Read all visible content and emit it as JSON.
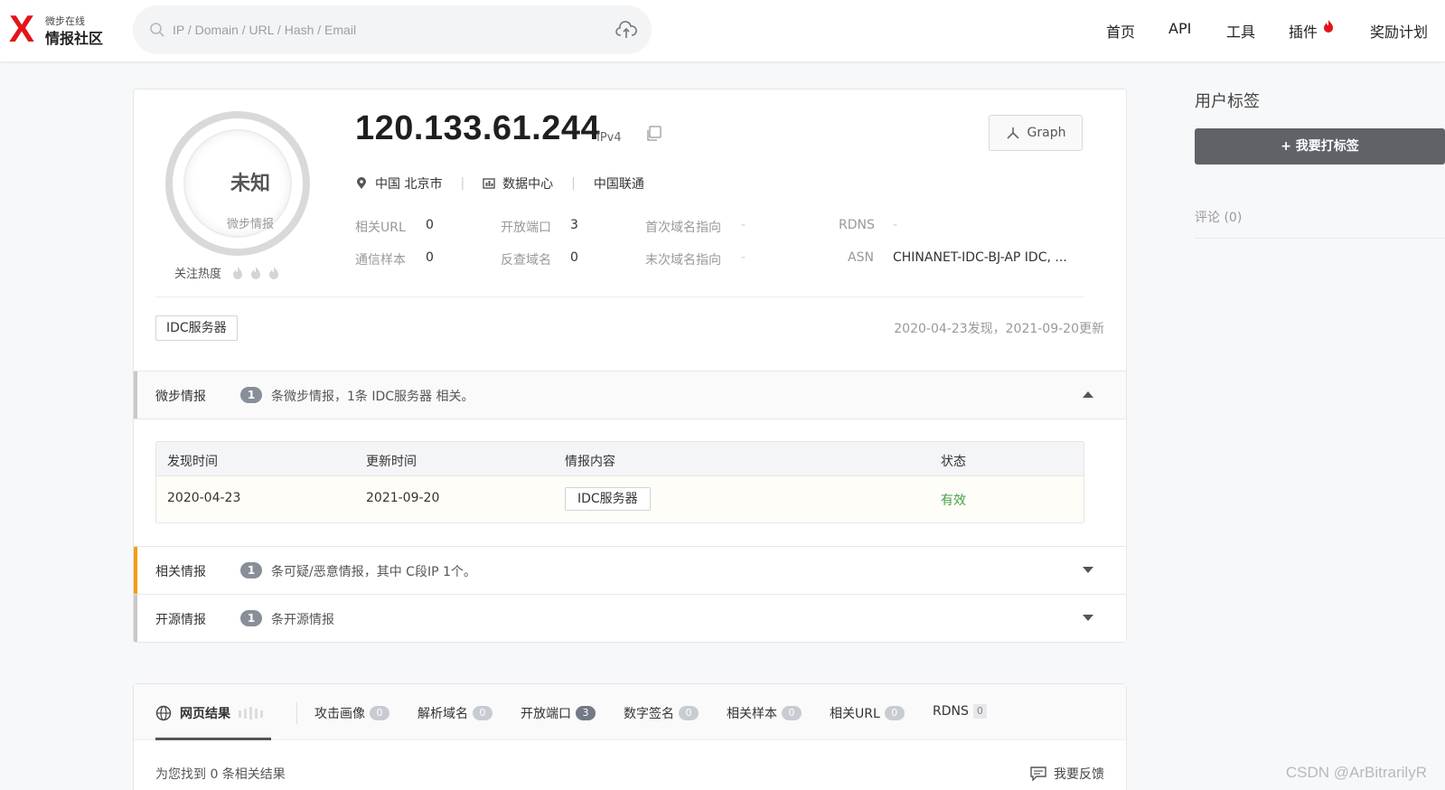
{
  "logo": {
    "mark": "X",
    "sub": "微步在线",
    "main": "情报社区"
  },
  "search": {
    "placeholder": "IP / Domain / URL / Hash / Email"
  },
  "nav": {
    "home": "首页",
    "api": "API",
    "tools": "工具",
    "plugins": "插件",
    "rewards": "奖励计划"
  },
  "summary": {
    "verdict": "未知",
    "verdict_source": "微步情报",
    "heat_label": "关注热度",
    "ip": "120.133.61.244",
    "ip_version": "IPv4",
    "graph_label": "Graph",
    "location": "中国 北京市",
    "scene": "数据中心",
    "isp": "中国联通",
    "related_url_label": "相关URL",
    "related_url": "0",
    "comm_sample_label": "通信样本",
    "comm_sample": "0",
    "open_port_label": "开放端口",
    "open_port": "3",
    "reverse_domain_label": "反查域名",
    "reverse_domain": "0",
    "first_domain_label": "首次域名指向",
    "first_domain": "-",
    "last_domain_label": "末次域名指向",
    "last_domain": "-",
    "rdns_label": "RDNS",
    "rdns": "-",
    "asn_label": "ASN",
    "asn": "CHINANET-IDC-BJ-AP IDC, ...",
    "tag": "IDC服务器",
    "dates": "2020-04-23发现，2021-09-20更新"
  },
  "sections": {
    "threatbook": {
      "title": "微步情报",
      "count": "1",
      "text": "条微步情报，1条 IDC服务器 相关。"
    },
    "related": {
      "title": "相关情报",
      "count": "1",
      "text": "条可疑/恶意情报，其中 C段IP 1个。"
    },
    "opensource": {
      "title": "开源情报",
      "count": "1",
      "text": "条开源情报"
    }
  },
  "intel_table": {
    "headers": [
      "发现时间",
      "更新时间",
      "情报内容",
      "状态"
    ],
    "rows": [
      {
        "found": "2020-04-23",
        "updated": "2021-09-20",
        "content": "IDC服务器",
        "status": "有效"
      }
    ]
  },
  "sidebar": {
    "title": "用户标签",
    "tag_button": "+ 我要打标签",
    "comments": "评论 (0)"
  },
  "tabs": [
    {
      "label": "网页结果",
      "count": ""
    },
    {
      "label": "攻击画像",
      "count": "0"
    },
    {
      "label": "解析域名",
      "count": "0"
    },
    {
      "label": "开放端口",
      "count": "3"
    },
    {
      "label": "数字签名",
      "count": "0"
    },
    {
      "label": "相关样本",
      "count": "0"
    },
    {
      "label": "相关URL",
      "count": "0"
    },
    {
      "label": "RDNS",
      "count": "0"
    }
  ],
  "results": {
    "text": "为您找到 0 条相关结果",
    "feedback": "我要反馈"
  },
  "watermark": "CSDN @ArBitrarilyR",
  "colors": {
    "brand_red": "#e4131b",
    "valid_green": "#43a047",
    "related_accent": "#f39c12"
  }
}
